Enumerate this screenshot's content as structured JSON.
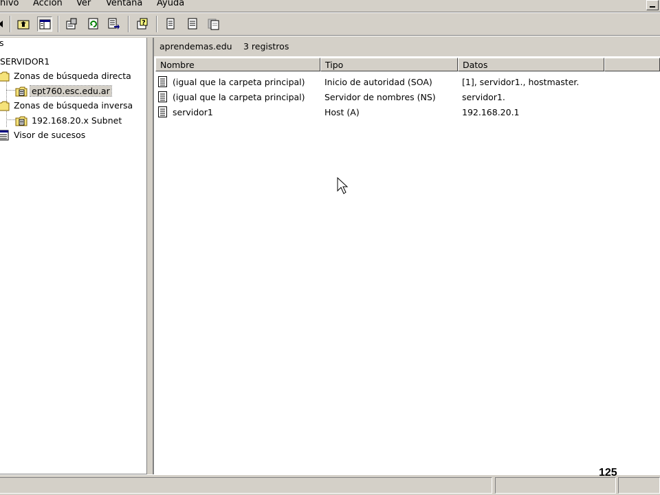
{
  "menu": {
    "items": [
      {
        "label": "hivo"
      },
      {
        "label": "Acción"
      },
      {
        "label": "Ver"
      },
      {
        "label": "Ventana"
      },
      {
        "label": "Ayuda"
      }
    ]
  },
  "toolbar": {
    "buttons": [
      "back-icon",
      "up-folder-icon",
      "show-hide-tree-icon",
      "properties-icon",
      "refresh-icon",
      "export-list-icon",
      "help-icon",
      "new-record-icon",
      "new-host-icon",
      "new-domain-icon"
    ]
  },
  "tree": {
    "root_partial": "s",
    "server": "SERVIDOR1",
    "forward_zones": "Zonas de búsqueda directa",
    "forward_zone_item": "ept760.esc.edu.ar",
    "reverse_zones": "Zonas de búsqueda inversa",
    "reverse_zone_item": "192.168.20.x Subnet",
    "event_viewer": "Visor de sucesos"
  },
  "right": {
    "zone_name": "aprendemas.edu",
    "record_count": "3 registros",
    "columns": [
      "Nombre",
      "Tipo",
      "Datos"
    ],
    "rows": [
      {
        "name": "(igual que la carpeta principal)",
        "type": "Inicio de autoridad (SOA)",
        "data": "[1], servidor1., hostmaster."
      },
      {
        "name": "(igual que la carpeta principal)",
        "type": "Servidor de nombres (NS)",
        "data": "servidor1."
      },
      {
        "name": "servidor1",
        "type": "Host (A)",
        "data": "192.168.20.1"
      }
    ]
  },
  "page_number": "125"
}
